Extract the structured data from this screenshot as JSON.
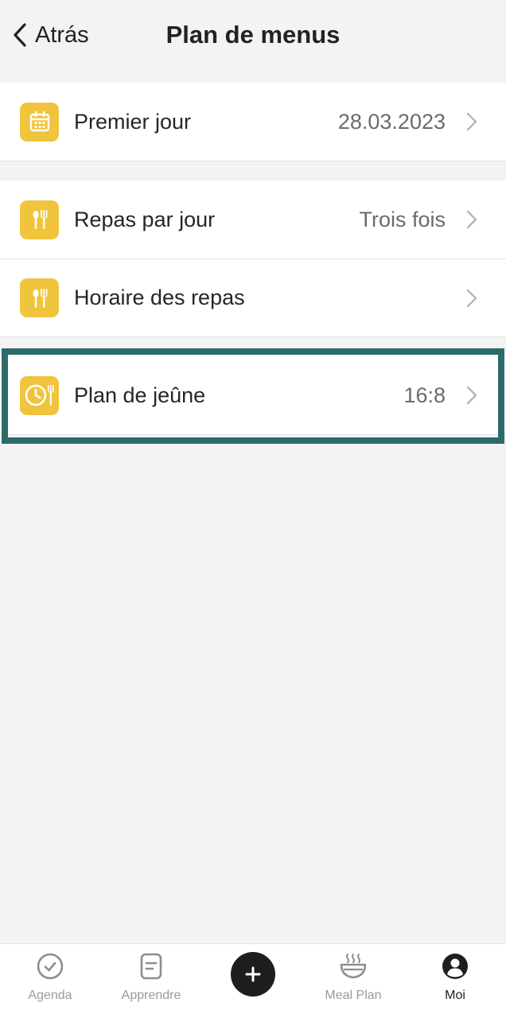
{
  "header": {
    "back_label": "Atrás",
    "title": "Plan de menus"
  },
  "settings": {
    "first_day": {
      "label": "Premier jour",
      "value": "28.03.2023",
      "icon": "calendar-icon"
    },
    "meals_per_day": {
      "label": "Repas par jour",
      "value": "Trois fois",
      "icon": "fork-knife-icon"
    },
    "meal_schedule": {
      "label": "Horaire des repas",
      "value": "",
      "icon": "fork-knife-icon"
    },
    "fasting_plan": {
      "label": "Plan de jeûne",
      "value": "16:8",
      "icon": "clock-fork-icon"
    }
  },
  "tabbar": {
    "items": [
      {
        "label": "Agenda",
        "icon": "check-circle-icon"
      },
      {
        "label": "Apprendre",
        "icon": "document-icon"
      },
      {
        "label": "",
        "icon": "plus-icon"
      },
      {
        "label": "Meal Plan",
        "icon": "bowl-icon"
      },
      {
        "label": "Moi",
        "icon": "profile-icon"
      }
    ]
  },
  "colors": {
    "accent": "#f0c43c",
    "highlight_border": "#2d6b6b",
    "background": "#f3f3f3"
  }
}
